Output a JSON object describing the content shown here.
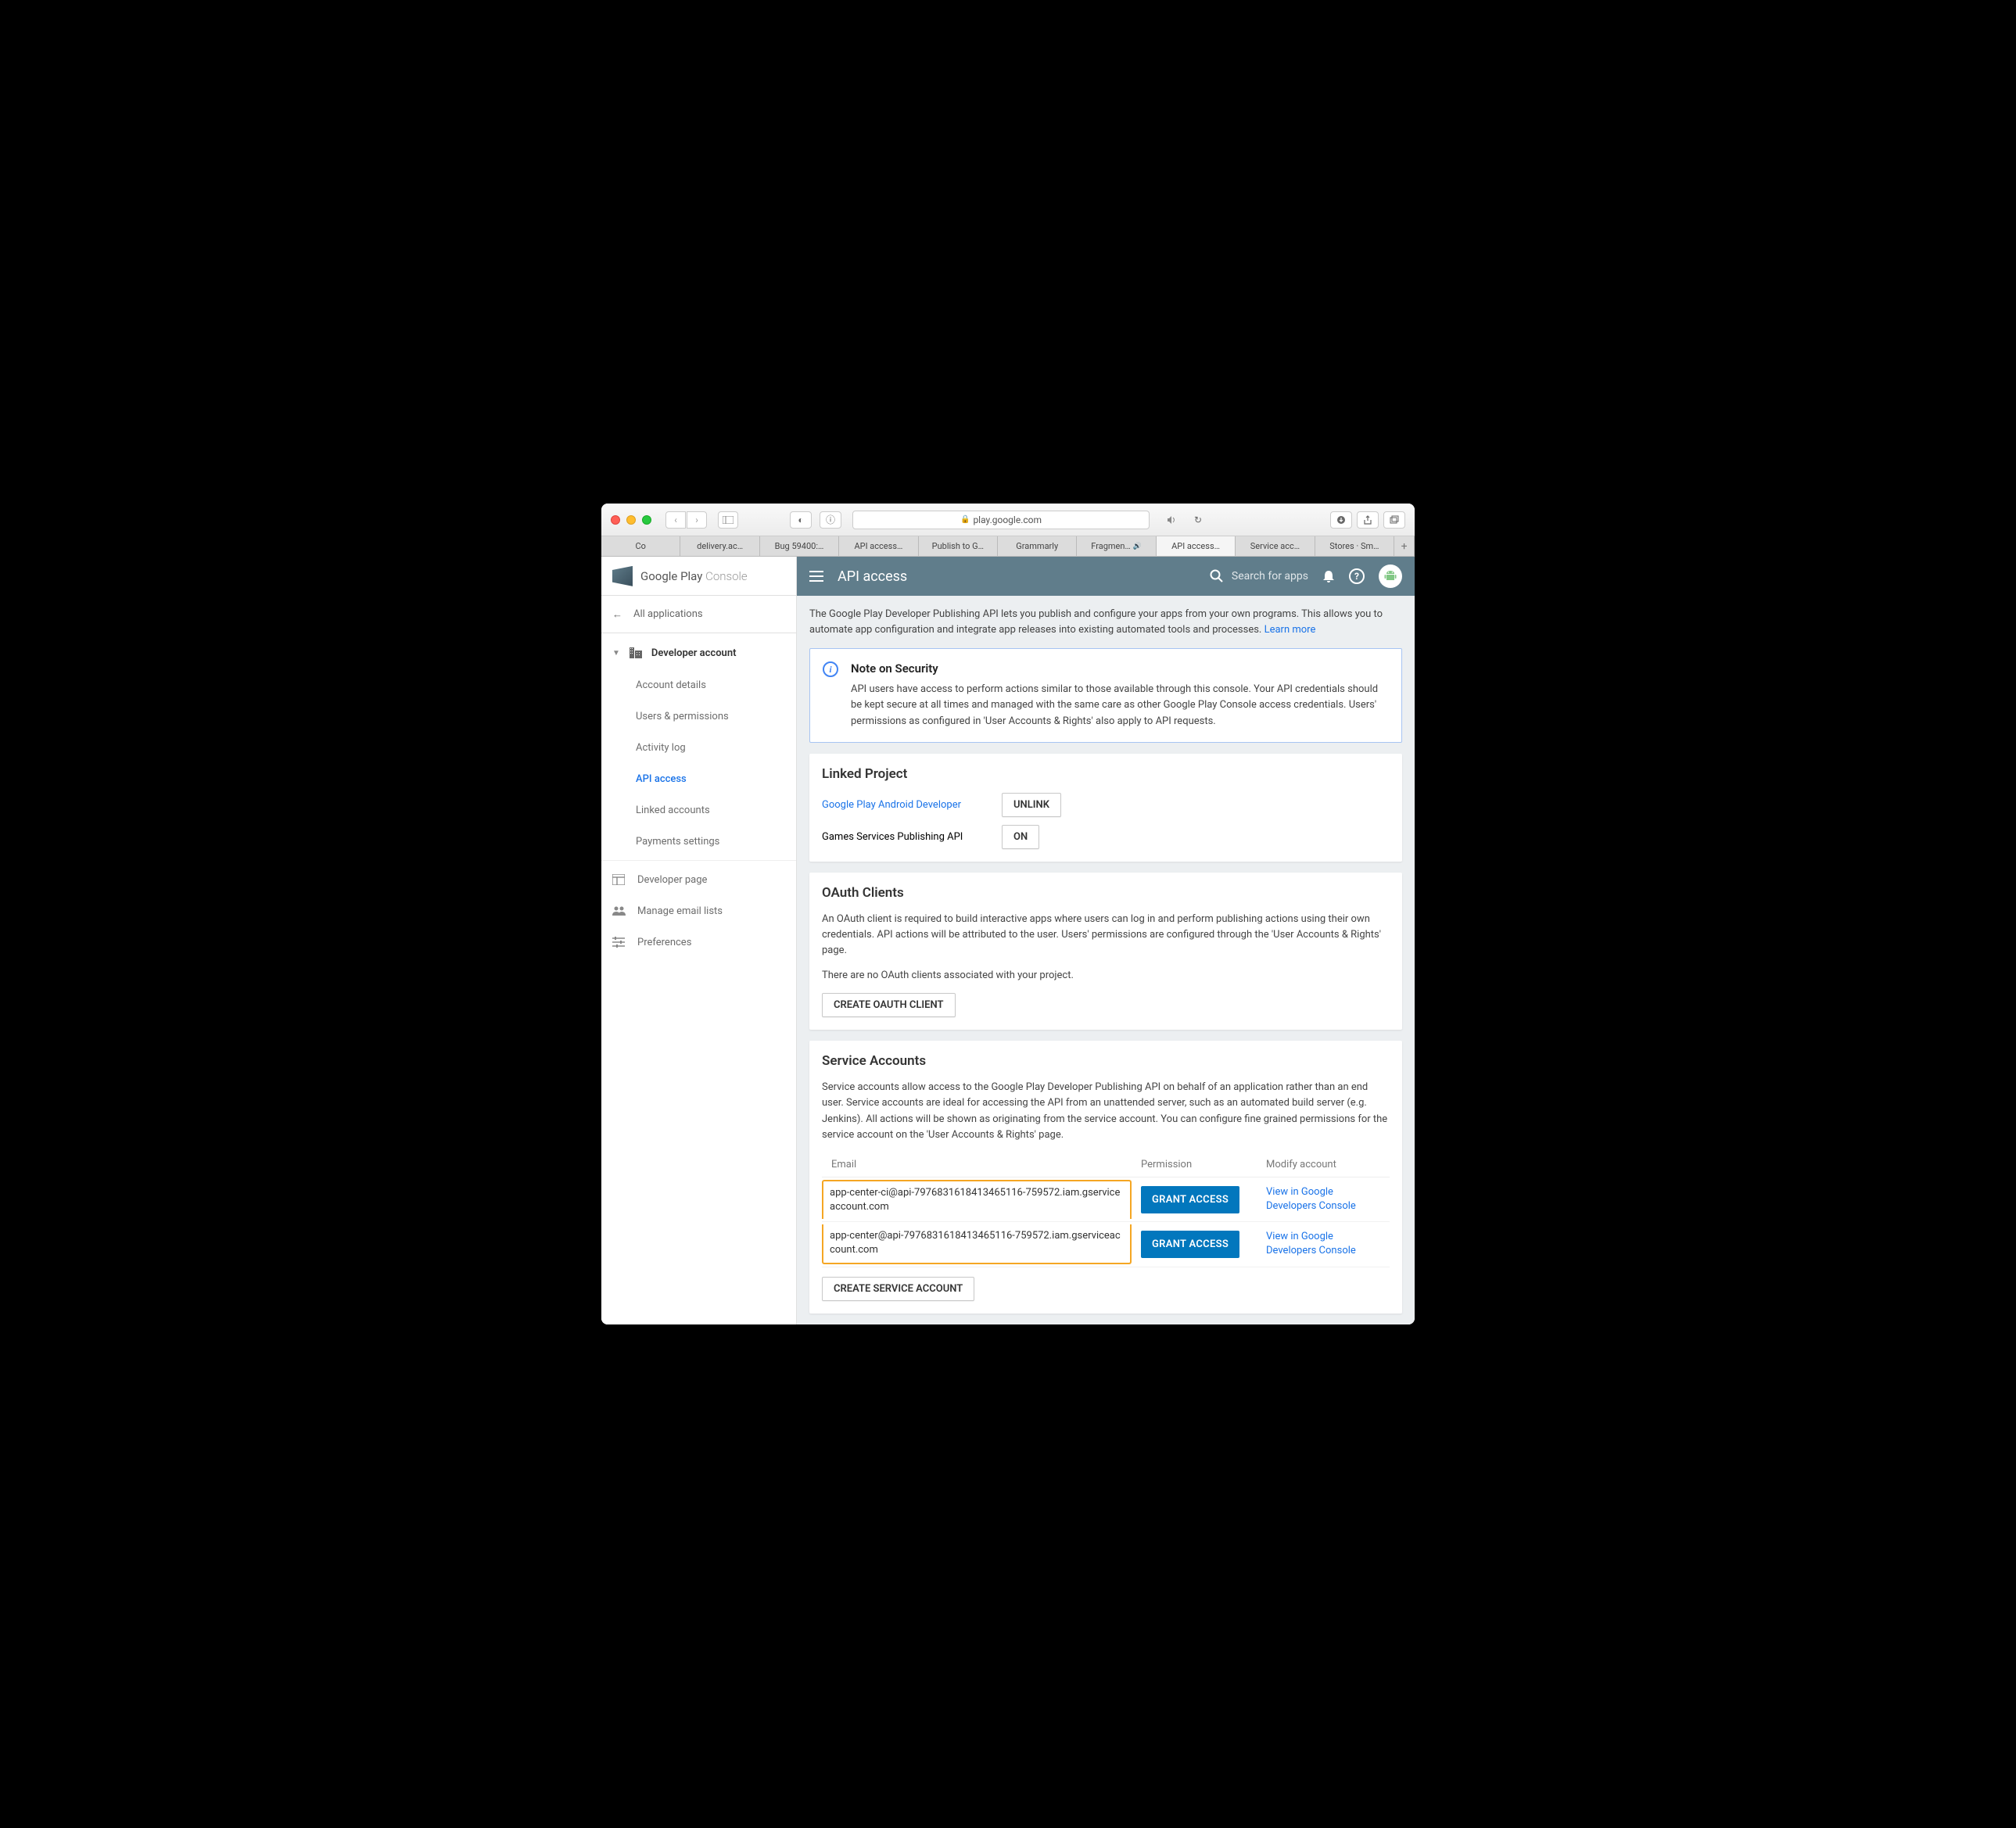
{
  "browser": {
    "url": "play.google.com",
    "tabs": [
      "Co",
      "delivery.ac…",
      "Bug 59400:…",
      "API access…",
      "Publish to G…",
      "Grammarly",
      "Fragmen…",
      "API access…",
      "Service acc…",
      "Stores · Sm…"
    ],
    "active_tab_index": 7
  },
  "brand": {
    "name": "Google Play",
    "suffix": "Console"
  },
  "sidebar": {
    "all_apps": "All applications",
    "section_head": "Developer account",
    "items": [
      "Account details",
      "Users & permissions",
      "Activity log",
      "API access",
      "Linked accounts",
      "Payments settings"
    ],
    "active_index": 3,
    "extras": [
      "Developer page",
      "Manage email lists",
      "Preferences"
    ]
  },
  "header": {
    "title": "API access",
    "search_placeholder": "Search for apps"
  },
  "intro": {
    "text": "The Google Play Developer Publishing API lets you publish and configure your apps from your own programs. This allows you to automate app configuration and integrate app releases into existing automated tools and processes. ",
    "learn_more": "Learn more"
  },
  "note": {
    "title": "Note on Security",
    "body": "API users have access to perform actions similar to those available through this console. Your API credentials should be kept secure at all times and managed with the same care as other Google Play Console access credentials. Users' permissions as configured in 'User Accounts & Rights' also apply to API requests."
  },
  "linked_project": {
    "title": "Linked Project",
    "rows": [
      {
        "name": "Google Play Android Developer",
        "btn": "UNLINK",
        "link": true
      },
      {
        "name": "Games Services Publishing API",
        "btn": "ON",
        "link": false
      }
    ]
  },
  "oauth": {
    "title": "OAuth Clients",
    "desc": "An OAuth client is required to build interactive apps where users can log in and perform publishing actions using their own credentials. API actions will be attributed to the user. Users' permissions are configured through the 'User Accounts & Rights' page.",
    "empty": "There are no OAuth clients associated with your project.",
    "create_btn": "CREATE OAUTH CLIENT"
  },
  "service_accounts": {
    "title": "Service Accounts",
    "desc": "Service accounts allow access to the Google Play Developer Publishing API on behalf of an application rather than an end user. Service accounts are ideal for accessing the API from an unattended server, such as an automated build server (e.g. Jenkins). All actions will be shown as originating from the service account. You can configure fine grained permissions for the service account on the 'User Accounts & Rights' page.",
    "headers": [
      "Email",
      "Permission",
      "Modify account"
    ],
    "rows": [
      {
        "email": "app-center-ci@api-7976831618413465116-759572.iam.gserviceaccount.com",
        "grant": "GRANT ACCESS",
        "view": "View in Google Developers Console"
      },
      {
        "email": "app-center@api-7976831618413465116-759572.iam.gserviceaccount.com",
        "grant": "GRANT ACCESS",
        "view": "View in Google Developers Console"
      }
    ],
    "create_btn": "CREATE SERVICE ACCOUNT"
  }
}
